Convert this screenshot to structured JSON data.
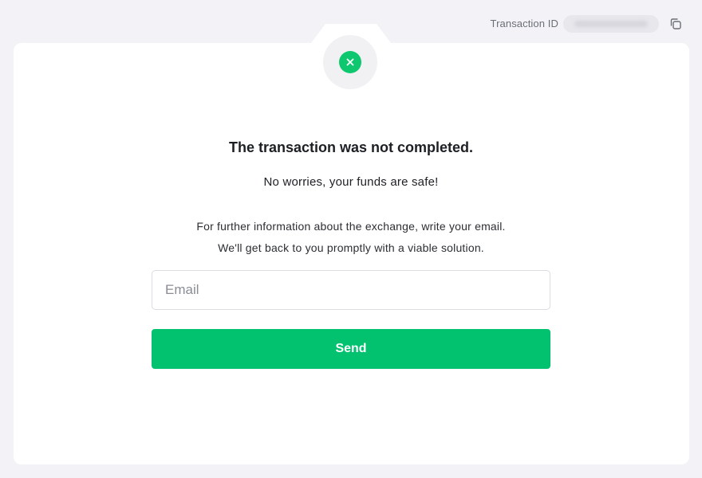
{
  "header": {
    "transaction_id_label": "Transaction ID",
    "transaction_id_value": ""
  },
  "status": {
    "icon": "close-icon",
    "icon_color": "#0ec76f"
  },
  "message": {
    "title": "The transaction was not completed.",
    "subtitle": "No worries, your funds are safe!",
    "info_line_1": "For further information about the exchange, write your email.",
    "info_line_2": "We'll get back to you promptly with a viable solution."
  },
  "form": {
    "email_placeholder": "Email",
    "email_value": "",
    "send_label": "Send"
  },
  "colors": {
    "accent": "#02c26f",
    "background": "#f3f2f7",
    "card": "#ffffff"
  }
}
